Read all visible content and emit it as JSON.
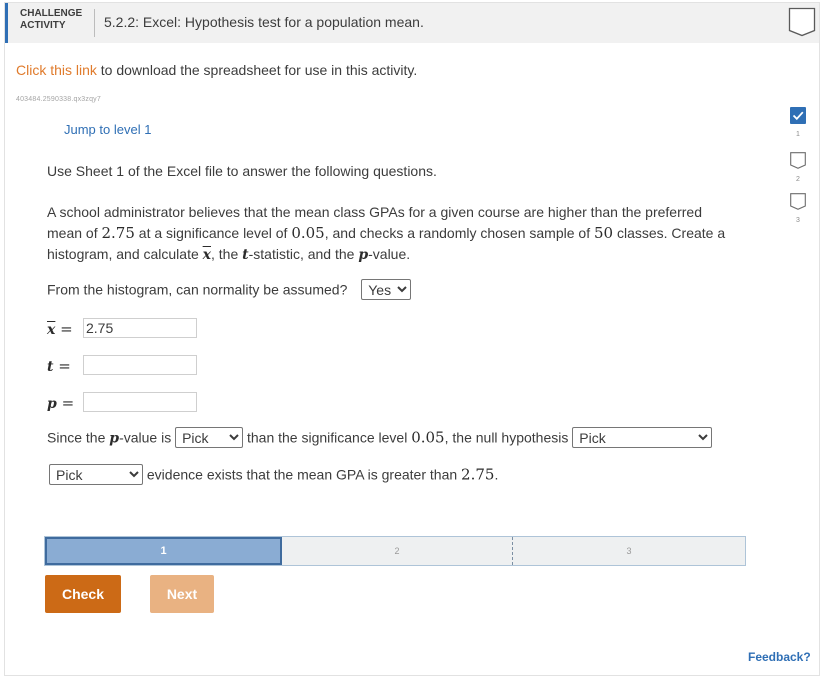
{
  "header": {
    "label_line1": "CHALLENGE",
    "label_line2": "ACTIVITY",
    "title": "5.2.2: Excel: Hypothesis test for a population mean."
  },
  "download": {
    "link_text": "Click this link",
    "rest_text": " to download the spreadsheet for use in this activity."
  },
  "activity_id": "403484.2590338.qx3zqy7",
  "jump_link": "Jump to level 1",
  "levels": [
    {
      "number": "1",
      "status": "completed"
    },
    {
      "number": "2",
      "status": "incomplete"
    },
    {
      "number": "3",
      "status": "incomplete"
    }
  ],
  "question": {
    "intro": "Use Sheet 1 of the Excel file to answer the following questions.",
    "p1_a": "A school administrator believes that the mean class GPAs for a given course are higher than the preferred",
    "p1_b": "mean of ",
    "mean": "2.75",
    "p1_c": " at a significance level of ",
    "alpha": "0.05",
    "p1_d": ", and checks a randomly chosen sample of ",
    "n": "50",
    "p1_e": " classes. Create a",
    "p1_f": "histogram, and calculate ",
    "xbar_sym": "x",
    "p1_g": ", the ",
    "t_sym": "t",
    "p1_h": "-statistic, and the ",
    "p_sym": "p",
    "p1_i": "-value.",
    "normality_q": "From the histogram, can normality be assumed?",
    "normality_selected": "Yes",
    "eq_x": "2.75",
    "eq_t": "",
    "eq_p": "",
    "since_a": "Since the ",
    "since_b": "-value is ",
    "compare_selected": "Pick",
    "since_c": " than the significance level ",
    "since_alpha": "0.05",
    "since_d": ", the null hypothesis ",
    "hyp_selected": "Pick",
    "evidence_selected": "Pick",
    "evidence_a": " evidence exists that the mean GPA is greater than ",
    "evidence_val": "2.75",
    "evidence_end": "."
  },
  "progress": {
    "seg1": "1",
    "seg2": "2",
    "seg3": "3"
  },
  "buttons": {
    "check": "Check",
    "next": "Next"
  },
  "feedback": "Feedback?",
  "colors": {
    "accent": "#2f6fb5",
    "link": "#e07b2c",
    "check": "#cc6a16",
    "next": "#e9b282"
  }
}
